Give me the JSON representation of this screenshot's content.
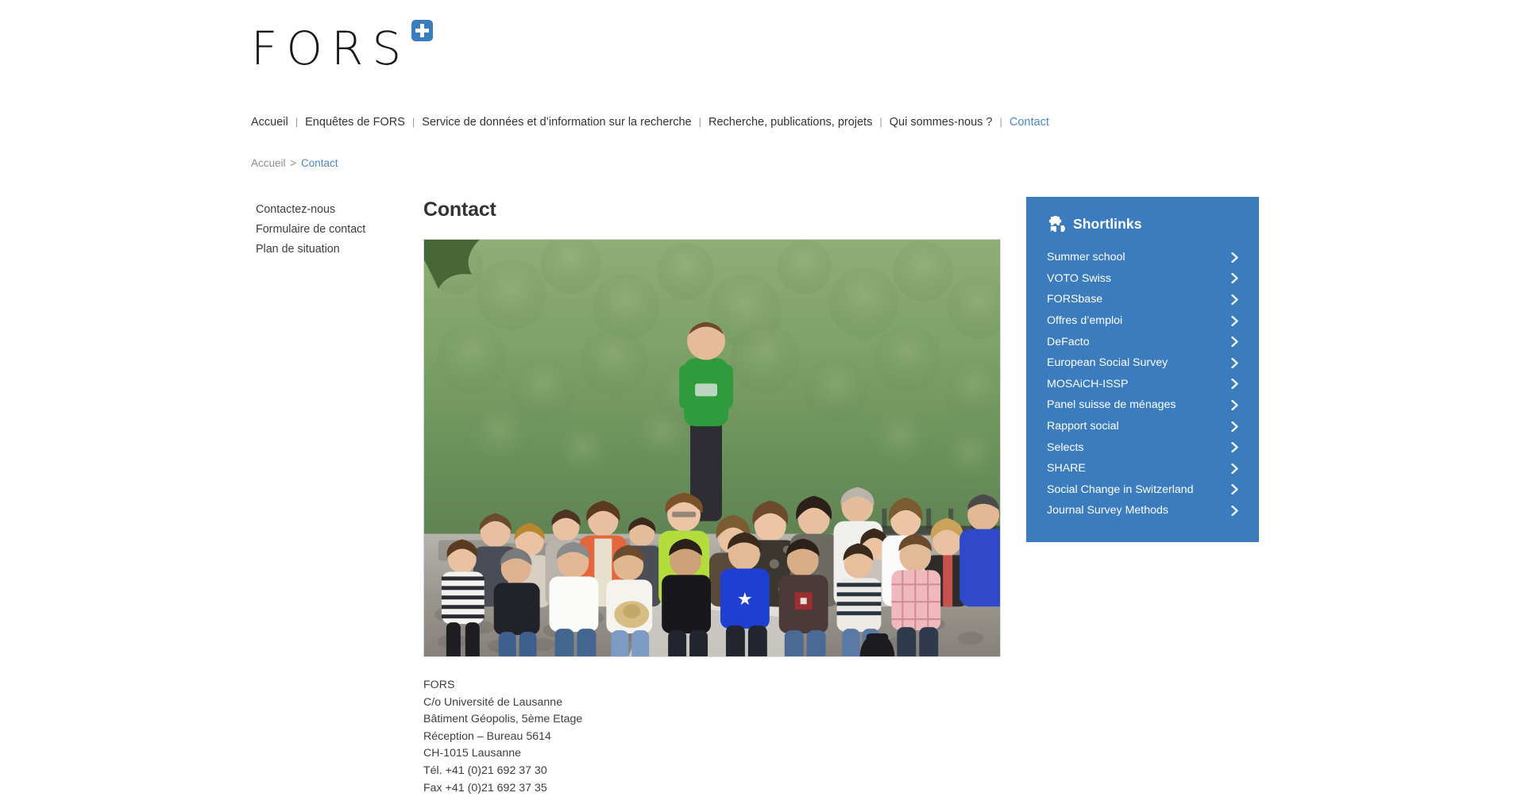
{
  "site": {
    "logo_text": "FORS",
    "logo_badge_icon": "swiss-cross-plus-icon"
  },
  "mainnav": {
    "separator": "|",
    "items": [
      {
        "label": "Accueil",
        "active": false
      },
      {
        "label": "Enquêtes de FORS",
        "active": false
      },
      {
        "label": "Service de données et d’information sur la recherche",
        "active": false
      },
      {
        "label": "Recherche, publications, projets",
        "active": false
      },
      {
        "label": "Qui sommes-nous ?",
        "active": false
      },
      {
        "label": "Contact",
        "active": true
      }
    ]
  },
  "breadcrumb": {
    "home": "Accueil",
    "separator": ">",
    "current": "Contact"
  },
  "subnav": {
    "items": [
      {
        "label": "Contactez-nous"
      },
      {
        "label": "Formulaire de contact"
      },
      {
        "label": "Plan de situation"
      }
    ]
  },
  "main": {
    "title": "Contact",
    "photo": {
      "alt": "Photo de groupe de l’équipe FORS devant une forêt",
      "icon": "team-group-photo"
    },
    "address": [
      "FORS",
      "C/o Université de Lausanne",
      "Bâtiment Géopolis, 5ème Etage",
      "Réception – Bureau 5614",
      "CH-1015 Lausanne",
      "Tél. +41 (0)21 692 37 30",
      "Fax +41 (0)21 692 37 35"
    ]
  },
  "shortlinks": {
    "title": "Shortlinks",
    "icon": "puzzle-piece-icon",
    "chevron_icon": "chevron-right-icon",
    "items": [
      {
        "label": "Summer school"
      },
      {
        "label": "VOTO Swiss"
      },
      {
        "label": "FORSbase"
      },
      {
        "label": "Offres d’emploi"
      },
      {
        "label": "DeFacto"
      },
      {
        "label": "European Social Survey"
      },
      {
        "label": "MOSAiCH-ISSP"
      },
      {
        "label": "Panel suisse de ménages"
      },
      {
        "label": "Rapport social"
      },
      {
        "label": "Selects"
      },
      {
        "label": "SHARE"
      },
      {
        "label": "Social Change in Switzerland"
      },
      {
        "label": "Journal Survey Methods"
      }
    ]
  },
  "colors": {
    "accent_blue": "#3b7cbe",
    "link_blue": "#4a86c8",
    "text": "#333333",
    "muted": "#8c8c8c",
    "background": "#ffffff"
  }
}
